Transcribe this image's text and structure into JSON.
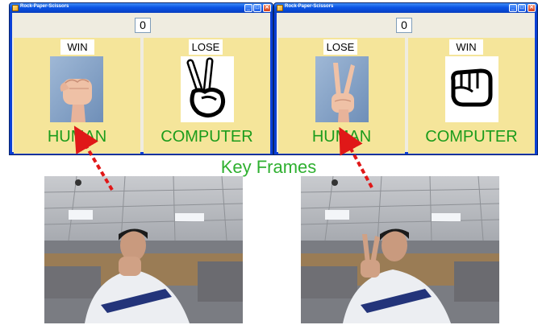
{
  "windows": [
    {
      "title": "Rock-Paper-Scissors",
      "score": "0",
      "human": {
        "result": "WIN",
        "name": "HUMAN",
        "gesture": "rock-fist-photo"
      },
      "computer": {
        "result": "LOSE",
        "name": "COMPUTER",
        "gesture": "scissors-hand-icon"
      }
    },
    {
      "title": "Rock-Paper-Scissors",
      "score": "0",
      "human": {
        "result": "LOSE",
        "name": "HUMAN",
        "gesture": "scissors-hand-photo"
      },
      "computer": {
        "result": "WIN",
        "name": "COMPUTER",
        "gesture": "rock-fist-icon"
      }
    }
  ],
  "window_controls": {
    "minimize": "_",
    "maximize": "□",
    "close": "✕"
  },
  "caption": "Key Frames",
  "colors": {
    "label_green": "#1c9c1c",
    "caption_green": "#2fb030",
    "arrow_red": "#e01818",
    "panel_yellow": "#f5e59a",
    "xp_blue": "#0a53e4"
  }
}
